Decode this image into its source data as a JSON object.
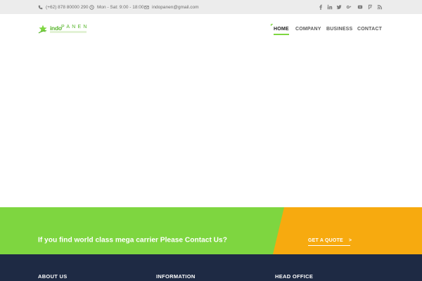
{
  "topbar": {
    "phone": "(+62) 878 80000 290",
    "hours": "Mon - Sat: 9:00 - 18:00",
    "email": "indopanen@gmail.com",
    "social": [
      "facebook-icon",
      "linkedin-icon",
      "twitter-icon",
      "google-plus-icon",
      "youtube-icon",
      "foursquare-icon",
      "rss-icon"
    ]
  },
  "header": {
    "logo_text": "indo",
    "logo_text2": "PANEN"
  },
  "nav": {
    "items": [
      {
        "label": "HOME",
        "active": true
      },
      {
        "label": "COMPANY",
        "active": false
      },
      {
        "label": "BUSINESS",
        "active": false
      },
      {
        "label": "CONTACT",
        "active": false
      }
    ]
  },
  "cta": {
    "text": "If you find world class mega carrier Please Contact Us?",
    "button_label": "GET A QUOTE",
    "button_arrow": ">"
  },
  "footer": {
    "headings": [
      "ABOUT US",
      "INFORMATION",
      "HEAD OFFICE"
    ]
  },
  "colors": {
    "accent_green": "#7ed640",
    "accent_orange": "#f7aa0f",
    "footer_navy": "#1e2a44",
    "topbar_gray": "#ececec"
  }
}
